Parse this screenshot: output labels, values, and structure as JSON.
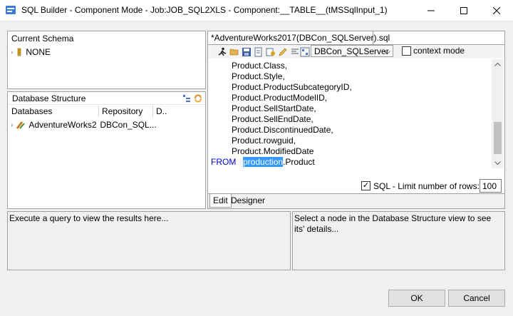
{
  "window": {
    "title": "SQL Builder - Component Mode - Job:JOB_SQL2XLS - Component:__TABLE__(tMSSqlInput_1)"
  },
  "current_schema": {
    "header": "Current Schema",
    "item": "NONE"
  },
  "database_structure": {
    "header": "Database Structure",
    "columns": [
      "Databases",
      "Repository",
      "D.."
    ],
    "row": {
      "database": "AdventureWorks20",
      "repository": "DBCon_SQL..."
    }
  },
  "editor": {
    "tab_label": "*AdventureWorks2017(DBCon_SQLServer).sql",
    "connection": "DBCon_SQLServer",
    "context_mode_label": "context mode",
    "code_lines": [
      "Product.Class,",
      "Product.Style,",
      "Product.ProductSubcategoryID,",
      "Product.ProductModelID,",
      "Product.SellStartDate,",
      "Product.SellEndDate,",
      "Product.DiscontinuedDate,",
      "Product.rowguid,",
      "Product.ModifiedDate"
    ],
    "from_keyword": "FROM",
    "from_schema": "production",
    "from_table": ".Product",
    "limit_label": "SQL - Limit number of rows:",
    "limit_checked": true,
    "limit_value": "100",
    "tabs": [
      "Edit",
      "Designer"
    ]
  },
  "results": {
    "message": "Execute a query to view the results here..."
  },
  "details": {
    "message": "Select a node in the Database Structure view to see its' details..."
  },
  "buttons": {
    "ok": "OK",
    "cancel": "Cancel"
  },
  "colors": {
    "keyword": "#0000c8",
    "selection": "#3399ff"
  }
}
